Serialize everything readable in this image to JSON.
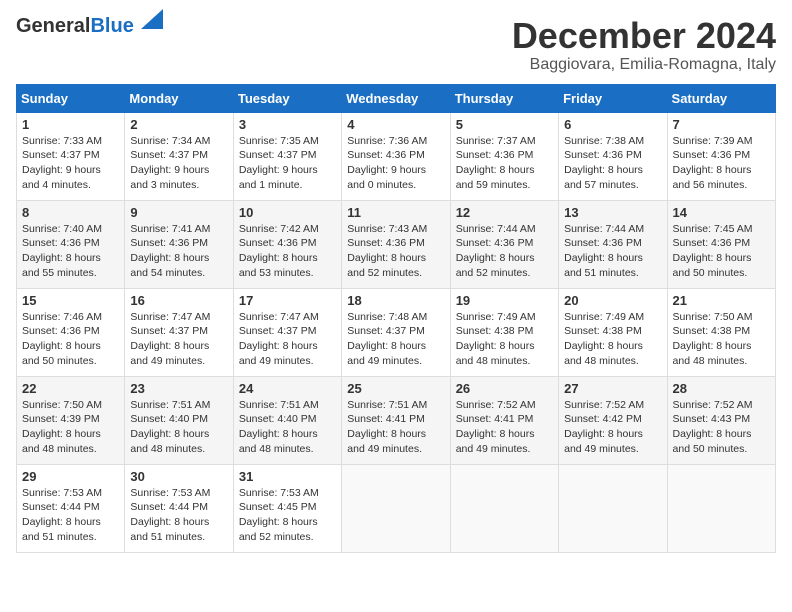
{
  "header": {
    "logo_general": "General",
    "logo_blue": "Blue",
    "title": "December 2024",
    "subtitle": "Baggiovara, Emilia-Romagna, Italy"
  },
  "calendar": {
    "columns": [
      "Sunday",
      "Monday",
      "Tuesday",
      "Wednesday",
      "Thursday",
      "Friday",
      "Saturday"
    ],
    "weeks": [
      [
        {
          "day": "1",
          "sunrise": "Sunrise: 7:33 AM",
          "sunset": "Sunset: 4:37 PM",
          "daylight": "Daylight: 9 hours and 4 minutes."
        },
        {
          "day": "2",
          "sunrise": "Sunrise: 7:34 AM",
          "sunset": "Sunset: 4:37 PM",
          "daylight": "Daylight: 9 hours and 3 minutes."
        },
        {
          "day": "3",
          "sunrise": "Sunrise: 7:35 AM",
          "sunset": "Sunset: 4:37 PM",
          "daylight": "Daylight: 9 hours and 1 minute."
        },
        {
          "day": "4",
          "sunrise": "Sunrise: 7:36 AM",
          "sunset": "Sunset: 4:36 PM",
          "daylight": "Daylight: 9 hours and 0 minutes."
        },
        {
          "day": "5",
          "sunrise": "Sunrise: 7:37 AM",
          "sunset": "Sunset: 4:36 PM",
          "daylight": "Daylight: 8 hours and 59 minutes."
        },
        {
          "day": "6",
          "sunrise": "Sunrise: 7:38 AM",
          "sunset": "Sunset: 4:36 PM",
          "daylight": "Daylight: 8 hours and 57 minutes."
        },
        {
          "day": "7",
          "sunrise": "Sunrise: 7:39 AM",
          "sunset": "Sunset: 4:36 PM",
          "daylight": "Daylight: 8 hours and 56 minutes."
        }
      ],
      [
        {
          "day": "8",
          "sunrise": "Sunrise: 7:40 AM",
          "sunset": "Sunset: 4:36 PM",
          "daylight": "Daylight: 8 hours and 55 minutes."
        },
        {
          "day": "9",
          "sunrise": "Sunrise: 7:41 AM",
          "sunset": "Sunset: 4:36 PM",
          "daylight": "Daylight: 8 hours and 54 minutes."
        },
        {
          "day": "10",
          "sunrise": "Sunrise: 7:42 AM",
          "sunset": "Sunset: 4:36 PM",
          "daylight": "Daylight: 8 hours and 53 minutes."
        },
        {
          "day": "11",
          "sunrise": "Sunrise: 7:43 AM",
          "sunset": "Sunset: 4:36 PM",
          "daylight": "Daylight: 8 hours and 52 minutes."
        },
        {
          "day": "12",
          "sunrise": "Sunrise: 7:44 AM",
          "sunset": "Sunset: 4:36 PM",
          "daylight": "Daylight: 8 hours and 52 minutes."
        },
        {
          "day": "13",
          "sunrise": "Sunrise: 7:44 AM",
          "sunset": "Sunset: 4:36 PM",
          "daylight": "Daylight: 8 hours and 51 minutes."
        },
        {
          "day": "14",
          "sunrise": "Sunrise: 7:45 AM",
          "sunset": "Sunset: 4:36 PM",
          "daylight": "Daylight: 8 hours and 50 minutes."
        }
      ],
      [
        {
          "day": "15",
          "sunrise": "Sunrise: 7:46 AM",
          "sunset": "Sunset: 4:36 PM",
          "daylight": "Daylight: 8 hours and 50 minutes."
        },
        {
          "day": "16",
          "sunrise": "Sunrise: 7:47 AM",
          "sunset": "Sunset: 4:37 PM",
          "daylight": "Daylight: 8 hours and 49 minutes."
        },
        {
          "day": "17",
          "sunrise": "Sunrise: 7:47 AM",
          "sunset": "Sunset: 4:37 PM",
          "daylight": "Daylight: 8 hours and 49 minutes."
        },
        {
          "day": "18",
          "sunrise": "Sunrise: 7:48 AM",
          "sunset": "Sunset: 4:37 PM",
          "daylight": "Daylight: 8 hours and 49 minutes."
        },
        {
          "day": "19",
          "sunrise": "Sunrise: 7:49 AM",
          "sunset": "Sunset: 4:38 PM",
          "daylight": "Daylight: 8 hours and 48 minutes."
        },
        {
          "day": "20",
          "sunrise": "Sunrise: 7:49 AM",
          "sunset": "Sunset: 4:38 PM",
          "daylight": "Daylight: 8 hours and 48 minutes."
        },
        {
          "day": "21",
          "sunrise": "Sunrise: 7:50 AM",
          "sunset": "Sunset: 4:38 PM",
          "daylight": "Daylight: 8 hours and 48 minutes."
        }
      ],
      [
        {
          "day": "22",
          "sunrise": "Sunrise: 7:50 AM",
          "sunset": "Sunset: 4:39 PM",
          "daylight": "Daylight: 8 hours and 48 minutes."
        },
        {
          "day": "23",
          "sunrise": "Sunrise: 7:51 AM",
          "sunset": "Sunset: 4:40 PM",
          "daylight": "Daylight: 8 hours and 48 minutes."
        },
        {
          "day": "24",
          "sunrise": "Sunrise: 7:51 AM",
          "sunset": "Sunset: 4:40 PM",
          "daylight": "Daylight: 8 hours and 48 minutes."
        },
        {
          "day": "25",
          "sunrise": "Sunrise: 7:51 AM",
          "sunset": "Sunset: 4:41 PM",
          "daylight": "Daylight: 8 hours and 49 minutes."
        },
        {
          "day": "26",
          "sunrise": "Sunrise: 7:52 AM",
          "sunset": "Sunset: 4:41 PM",
          "daylight": "Daylight: 8 hours and 49 minutes."
        },
        {
          "day": "27",
          "sunrise": "Sunrise: 7:52 AM",
          "sunset": "Sunset: 4:42 PM",
          "daylight": "Daylight: 8 hours and 49 minutes."
        },
        {
          "day": "28",
          "sunrise": "Sunrise: 7:52 AM",
          "sunset": "Sunset: 4:43 PM",
          "daylight": "Daylight: 8 hours and 50 minutes."
        }
      ],
      [
        {
          "day": "29",
          "sunrise": "Sunrise: 7:53 AM",
          "sunset": "Sunset: 4:44 PM",
          "daylight": "Daylight: 8 hours and 51 minutes."
        },
        {
          "day": "30",
          "sunrise": "Sunrise: 7:53 AM",
          "sunset": "Sunset: 4:44 PM",
          "daylight": "Daylight: 8 hours and 51 minutes."
        },
        {
          "day": "31",
          "sunrise": "Sunrise: 7:53 AM",
          "sunset": "Sunset: 4:45 PM",
          "daylight": "Daylight: 8 hours and 52 minutes."
        },
        null,
        null,
        null,
        null
      ]
    ]
  }
}
